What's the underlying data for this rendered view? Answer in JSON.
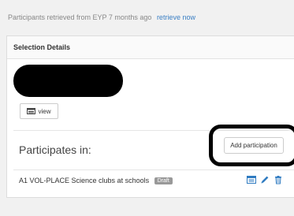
{
  "topbar": {
    "status_text": "Participants retrieved from EYP 7 months ago",
    "retrieve_link": "retrieve now"
  },
  "panel": {
    "heading": "Selection Details",
    "view_button": "view",
    "participates_label": "Participates in:",
    "add_button": "Add participation"
  },
  "participations": [
    {
      "title": "A1 VOL-PLACE Science clubs at schools",
      "status": "Draft"
    }
  ],
  "colors": {
    "link": "#3b7fc4",
    "badge_bg": "#999999",
    "action_icon": "#2f7bc1"
  },
  "icons": {
    "view": "list-card-icon",
    "row_actions": [
      "list-card-icon",
      "pencil-icon",
      "trash-icon"
    ]
  }
}
